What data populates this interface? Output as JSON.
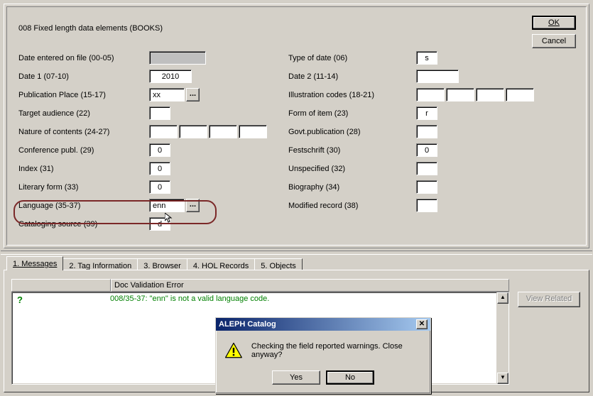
{
  "panel_title": "008 Fixed length data elements (BOOKS)",
  "buttons": {
    "ok": "OK",
    "cancel": "Cancel",
    "yes": "Yes",
    "no": "No",
    "view_related": "View Related"
  },
  "labels": {
    "date_entered": "Date entered on file (00-05)",
    "date1": "Date 1 (07-10)",
    "pub_place": "Publication Place (15-17)",
    "target_aud": "Target audience (22)",
    "nature": "Nature of contents (24-27)",
    "conf": "Conference publ. (29)",
    "index": "Index (31)",
    "litform": "Literary form (33)",
    "language": "Language (35-37)",
    "catsrc": "Cataloging source (39)",
    "type_date": "Type of date (06)",
    "date2": "Date 2 (11-14)",
    "ill": "Illustration codes (18-21)",
    "form_item": "Form of item (23)",
    "govt": "Govt.publication (28)",
    "fest": "Festschrift (30)",
    "unspec": "Unspecified (32)",
    "bio": "Biography (34)",
    "modrec": "Modified record (38)"
  },
  "values": {
    "date_entered": "",
    "date1": "2010",
    "pub_place": "xx",
    "target_aud": "",
    "nature": [
      "",
      "",
      "",
      ""
    ],
    "conf": "0",
    "index": "0",
    "litform": "0",
    "language": "enn",
    "catsrc": "d",
    "type_date": "s",
    "date2": "",
    "ill": [
      "",
      "",
      "",
      ""
    ],
    "form_item": "r",
    "govt": "",
    "fest": "0",
    "unspec": "",
    "bio": "",
    "modrec": ""
  },
  "picker_label": "...",
  "tabs": [
    "1. Messages",
    "2. Tag Information",
    "3. Browser",
    "4. HOL Records",
    "5. Objects"
  ],
  "active_tab": 0,
  "messages_header": {
    "col1": "",
    "col2": "Doc Validation Error"
  },
  "message_text": "008/35-37: \"enn\" is not a valid language code.",
  "dialog": {
    "title": "ALEPH Catalog",
    "text": "Checking the field reported warnings. Close anyway?"
  }
}
